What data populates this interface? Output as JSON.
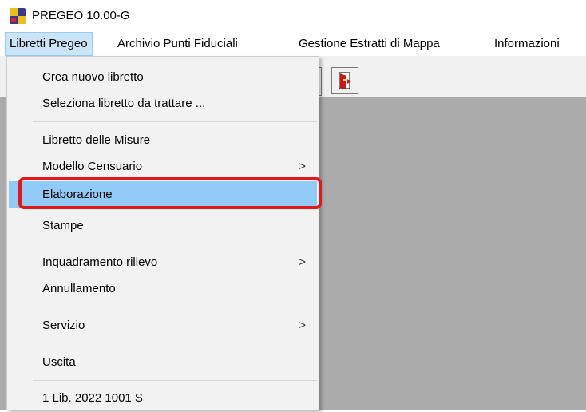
{
  "window": {
    "title": "PREGEO 10.00-G",
    "icon": "pregeo-app-icon"
  },
  "menubar": {
    "items": [
      {
        "label": "Libretti Pregeo"
      },
      {
        "label": "Archivio Punti Fiduciali"
      },
      {
        "label": "Gestione Estratti di Mappa"
      },
      {
        "label": "Informazioni"
      }
    ]
  },
  "toolbar": {
    "buttons": [
      {
        "icon": "exit-door-icon"
      }
    ]
  },
  "dropdown": {
    "items": [
      {
        "label": "Crea nuovo libretto"
      },
      {
        "label": "Seleziona libretto da trattare ..."
      },
      {
        "label": "Libretto delle Misure"
      },
      {
        "label": "Modello Censuario",
        "submenu": true
      },
      {
        "label": "Elaborazione",
        "highlighted": true
      },
      {
        "label": "Stampe"
      },
      {
        "label": "Inquadramento rilievo",
        "submenu": true
      },
      {
        "label": "Annullamento"
      },
      {
        "label": "Servizio",
        "submenu": true
      },
      {
        "label": "Uscita"
      },
      {
        "label": "1 Lib. 2022 1001 S"
      }
    ],
    "submenu_glyph": ">"
  },
  "colors": {
    "menu_highlight": "#91c9f7",
    "annotation_red": "#e0191c",
    "workspace_gray": "#ababab"
  }
}
